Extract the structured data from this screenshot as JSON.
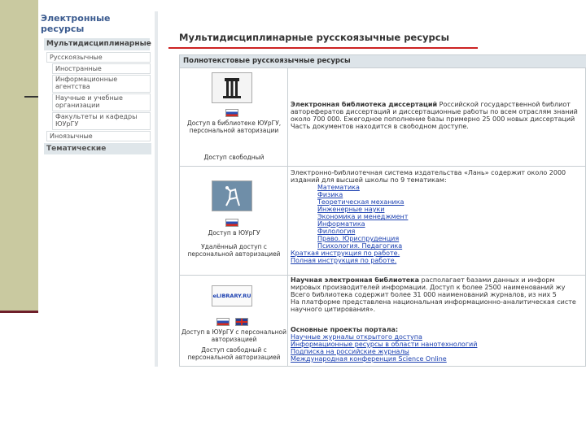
{
  "sidebar": {
    "title_line1": "Электронные",
    "title_line2": "ресурсы",
    "section_label": "Мультидисциплинарные",
    "items": [
      {
        "label": "Русскоязычные"
      },
      {
        "label": "Иностранные"
      },
      {
        "label": "Информационные агентства"
      },
      {
        "label": "Научные и учебные организации"
      },
      {
        "label": "Факультеты и кафедры ЮУрГУ"
      },
      {
        "label": "Иноязычные"
      }
    ],
    "thematic_label": "Тематические"
  },
  "main": {
    "title": "Мультидисциплинарные русскоязычные ресурсы",
    "table_header": "Полнотекстовые русскоязычные ресурсы",
    "rows": [
      {
        "logo": "rgb-library-logo",
        "access_caption": "Доступ в библиотеке ЮУрГУ, персональной авторизации",
        "access_note": "Доступ свободный",
        "text_bold": "Электронная библиотека диссертаций",
        "text_lines": [
          "Российской государственной библиот",
          "авторефератов диссертаций и диссертационные работы по всем отраслям знаний",
          "около 700 000. Ежегодное пополнение базы примерно 25 000 новых диссертаций",
          "Часть документов находится в свободном доступе."
        ]
      },
      {
        "logo": "lan-publisher-logo",
        "access_caption": "Доступ в ЮУрГУ",
        "access_note": "Удалённый доступ с персональной авторизацией",
        "intro_lines": [
          "Электронно-библиотечная система издательства «Лань» содержит около 2000",
          "изданий для высшей школы по 9 тематикам:"
        ],
        "topics": [
          "Математика",
          "Физика",
          "Теоретическая механика",
          "Инженерные науки",
          "Экономика и менеджмент",
          "Информатика",
          "Филология",
          "Право. Юриспруденция",
          "Психология. Педагогика"
        ],
        "links": [
          "Краткая инструкция по работе.",
          "Полная инструкция по работе."
        ]
      },
      {
        "logo": "elibrary-logo",
        "logo_text": "eLIBRARY.RU",
        "access_caption": "Доступ в ЮУрГУ с персональной авторизацией",
        "access_note": "Доступ свободный с персональной авторизацией",
        "text_bold": "Научная электронная библиотека",
        "text_lines": [
          "располагает базами данных и информ",
          "мировых производителей информации. Доступ к более 2500 наименований жу",
          "Всего библиотека содержит более 31 000 наименований журналов, из них 5",
          "На платформе представлена национальная информационно-аналитическая систе",
          "научного цитирования»."
        ],
        "projects_label": "Основные проекты портала:",
        "projects": [
          "Научные журналы открытого доступа",
          "Информационные ресурсы в области нанотехнологий",
          "Подписка на российские журналы",
          "Международная конференция Science Online"
        ]
      }
    ]
  }
}
